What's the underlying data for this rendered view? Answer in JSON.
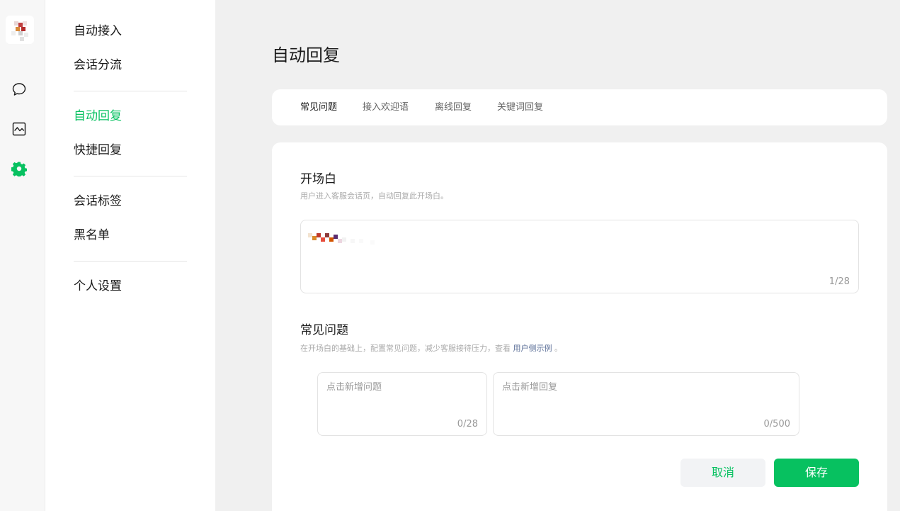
{
  "rail": {
    "icons": [
      "chat-icon",
      "stats-icon",
      "settings-icon"
    ],
    "accent": "#07c160"
  },
  "menu": {
    "groups": [
      [
        "自动接入",
        "会话分流"
      ],
      [
        "自动回复",
        "快捷回复"
      ],
      [
        "会话标签",
        "黑名单"
      ],
      [
        "个人设置"
      ]
    ],
    "active": "自动回复"
  },
  "page": {
    "title": "自动回复"
  },
  "tabs": [
    {
      "label": "常见问题",
      "active": true
    },
    {
      "label": "接入欢迎语",
      "active": false
    },
    {
      "label": "离线回复",
      "active": false
    },
    {
      "label": "关键词回复",
      "active": false
    }
  ],
  "opening": {
    "title": "开场白",
    "desc": "用户进入客服会话页，自动回复此开场白。",
    "counter": "1/28"
  },
  "faq": {
    "title": "常见问题",
    "desc_prefix": "在开场白的基础上，配置常见问题，减少客服接待压力，查看 ",
    "desc_link": "用户侧示例",
    "desc_suffix": " 。",
    "question_placeholder": "点击新增问题",
    "question_counter": "0/28",
    "answer_placeholder": "点击新增回复",
    "answer_counter": "0/500"
  },
  "actions": {
    "cancel": "取消",
    "save": "保存"
  },
  "colors": {
    "accent": "#07c160",
    "link": "#576b95"
  }
}
